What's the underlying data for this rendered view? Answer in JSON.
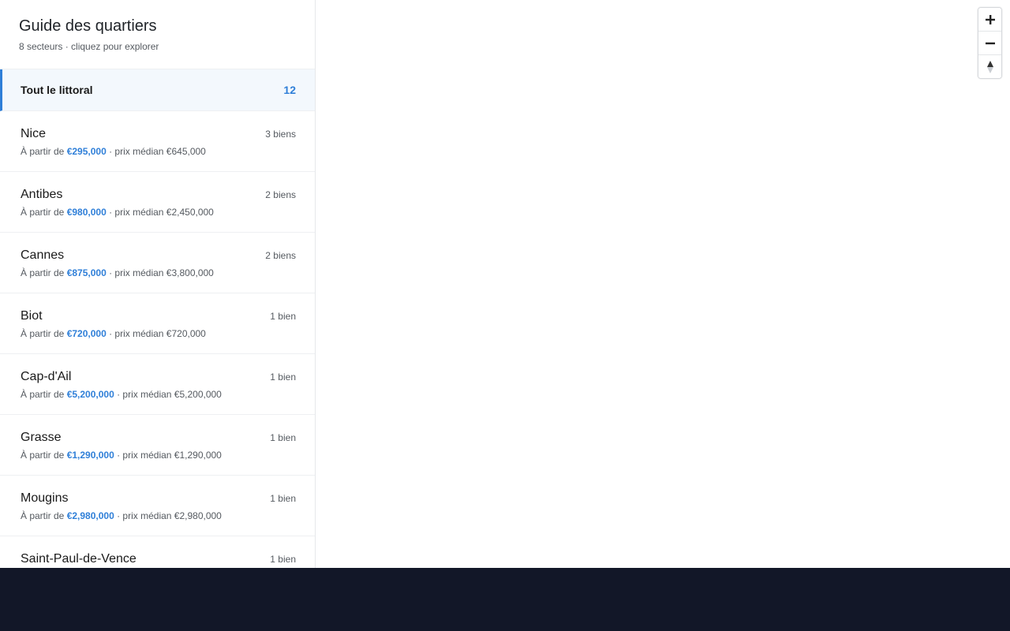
{
  "sidebar": {
    "title": "Guide des quartiers",
    "subtitle": "8 secteurs · cliquez pour explorer",
    "all": {
      "label": "Tout le littoral",
      "count": "12"
    },
    "items": [
      {
        "name": "Nice",
        "count": "3 biens",
        "prefix": "À partir de ",
        "min": "€295,000",
        "median": " · prix médian €645,000"
      },
      {
        "name": "Antibes",
        "count": "2 biens",
        "prefix": "À partir de ",
        "min": "€980,000",
        "median": " · prix médian €2,450,000"
      },
      {
        "name": "Cannes",
        "count": "2 biens",
        "prefix": "À partir de ",
        "min": "€875,000",
        "median": " · prix médian €3,800,000"
      },
      {
        "name": "Biot",
        "count": "1 bien",
        "prefix": "À partir de ",
        "min": "€720,000",
        "median": " · prix médian €720,000"
      },
      {
        "name": "Cap-d'Ail",
        "count": "1 bien",
        "prefix": "À partir de ",
        "min": "€5,200,000",
        "median": " · prix médian €5,200,000"
      },
      {
        "name": "Grasse",
        "count": "1 bien",
        "prefix": "À partir de ",
        "min": "€1,290,000",
        "median": " · prix médian €1,290,000"
      },
      {
        "name": "Mougins",
        "count": "1 bien",
        "prefix": "À partir de ",
        "min": "€2,980,000",
        "median": " · prix médian €2,980,000"
      },
      {
        "name": "Saint-Paul-de-Vence",
        "count": "1 bien",
        "prefix": "",
        "min": "",
        "median": ""
      }
    ]
  },
  "map": {
    "controls": [
      {
        "name": "zoom-in-button",
        "icon": "plus-icon"
      },
      {
        "name": "zoom-out-button",
        "icon": "minus-icon"
      },
      {
        "name": "reset-bearing-button",
        "icon": "compass-icon"
      }
    ]
  },
  "colors": {
    "accent": "#2f7fd8",
    "footer": "#121728",
    "selected_bg": "#f3f8fd"
  }
}
